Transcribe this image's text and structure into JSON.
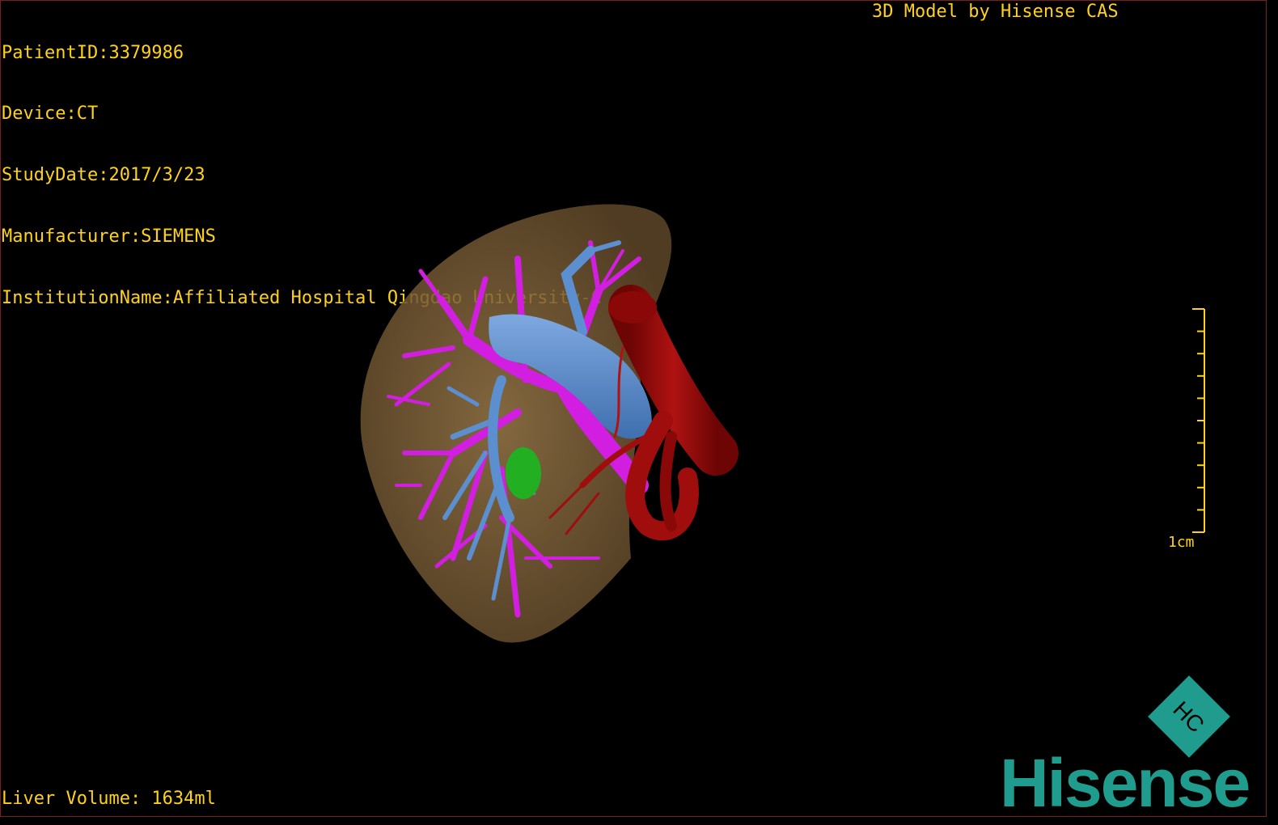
{
  "overlay": {
    "patient_id": "PatientID:3379986",
    "device": "Device:CT",
    "study_date": "StudyDate:2017/3/23",
    "manufacturer": "Manufacturer:SIEMENS",
    "institution": "InstitutionName:Affiliated Hospital Qingdao University-C",
    "model_credit": "3D Model by Hisense CAS",
    "liver_volume": "Liver Volume: 1634ml"
  },
  "scale_bar": {
    "label": "1cm",
    "tick_count": 10
  },
  "logo": {
    "wordmark": "Hisense",
    "mark_glyph": "HC"
  },
  "colors": {
    "overlay_text": "#ffd21a",
    "liver": "#8a6a3e",
    "hepatic_vein": "#d21ee0",
    "portal_vein": "#5b8fd0",
    "artery": "#a00d0d",
    "gallbladder": "#22b022",
    "brand": "#1f9c8e"
  }
}
